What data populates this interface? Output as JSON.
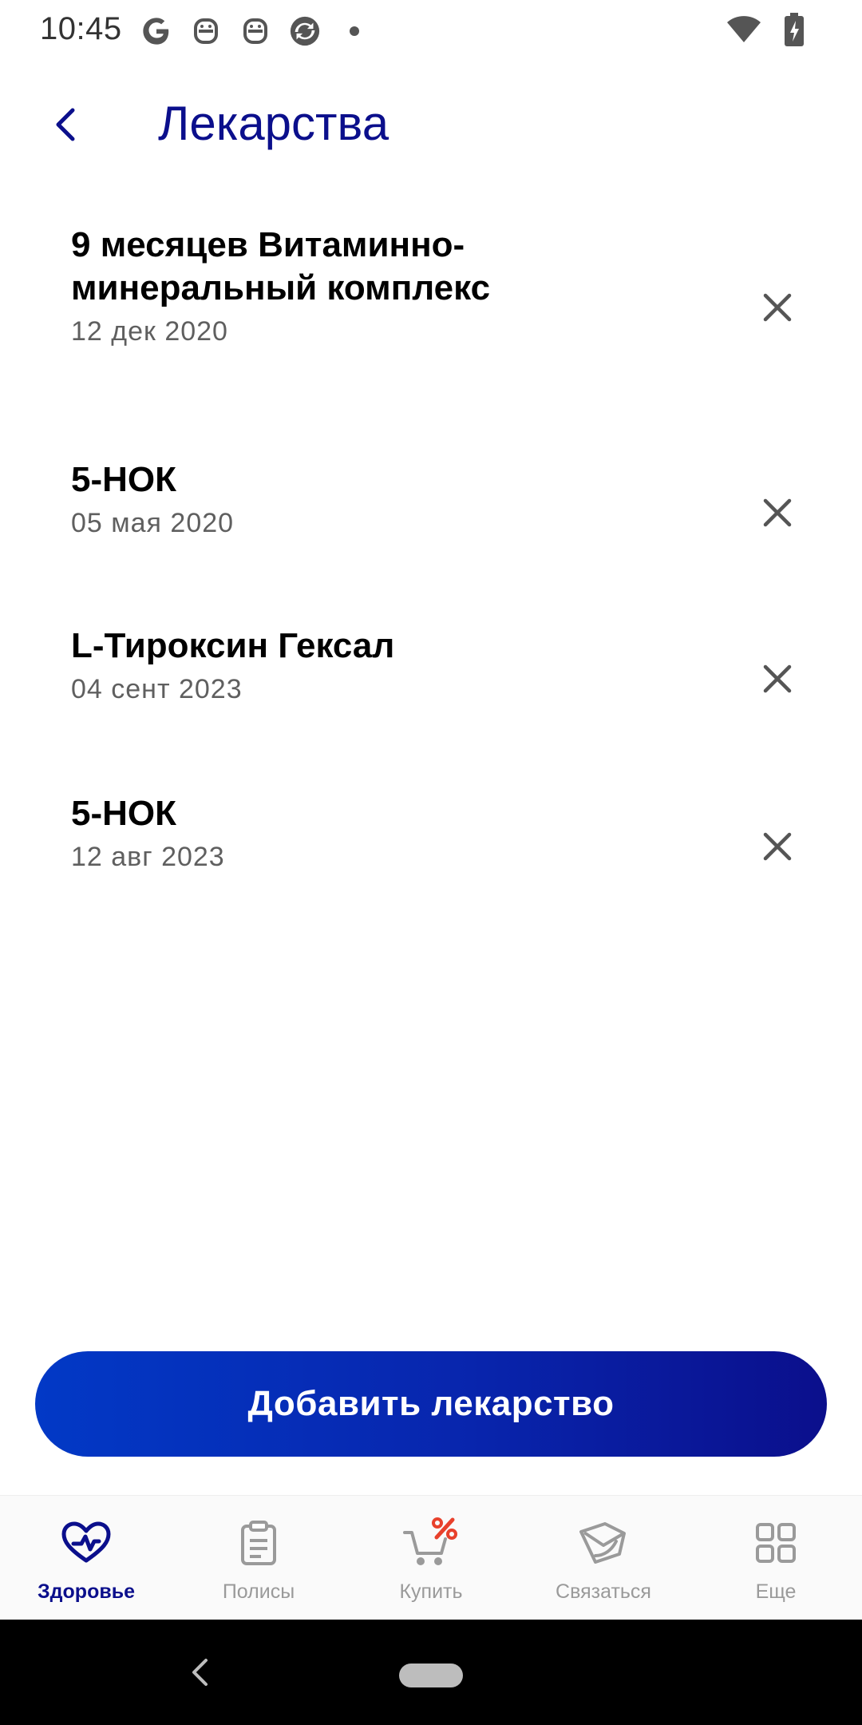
{
  "status_bar": {
    "time": "10:45",
    "left_icons": [
      "google-icon",
      "robot-icon",
      "robot-icon",
      "sync-app-icon",
      "dot-icon"
    ],
    "right_icons": [
      "wifi-icon",
      "battery-charging-icon"
    ]
  },
  "header": {
    "title": "Лекарства",
    "back_icon": "chevron-left-icon"
  },
  "medications": [
    {
      "name": "9 месяцев Витаминно-минеральный комплекс",
      "date": "12 дек 2020"
    },
    {
      "name": "5-НОК",
      "date": "05 мая 2020"
    },
    {
      "name": "L-Тироксин Гексал",
      "date": "04 сент 2023"
    },
    {
      "name": "5-НОК",
      "date": "12 авг 2023"
    }
  ],
  "add_button": {
    "label": "Добавить лекарство"
  },
  "bottom_nav": {
    "items": [
      {
        "label": "Здоровье",
        "icon": "heart-pulse-icon",
        "active": true
      },
      {
        "label": "Полисы",
        "icon": "clipboard-icon",
        "active": false
      },
      {
        "label": "Купить",
        "icon": "cart-percent-icon",
        "active": false
      },
      {
        "label": "Связаться",
        "icon": "phone-mail-icon",
        "active": false
      },
      {
        "label": "Еще",
        "icon": "grid-icon",
        "active": false
      }
    ]
  },
  "colors": {
    "accent": "#0b0f8c",
    "button_gradient_start": "#0239c6",
    "button_gradient_end": "#0b0f8c",
    "sale_red": "#e8412c",
    "inactive": "#9a9a9a"
  }
}
